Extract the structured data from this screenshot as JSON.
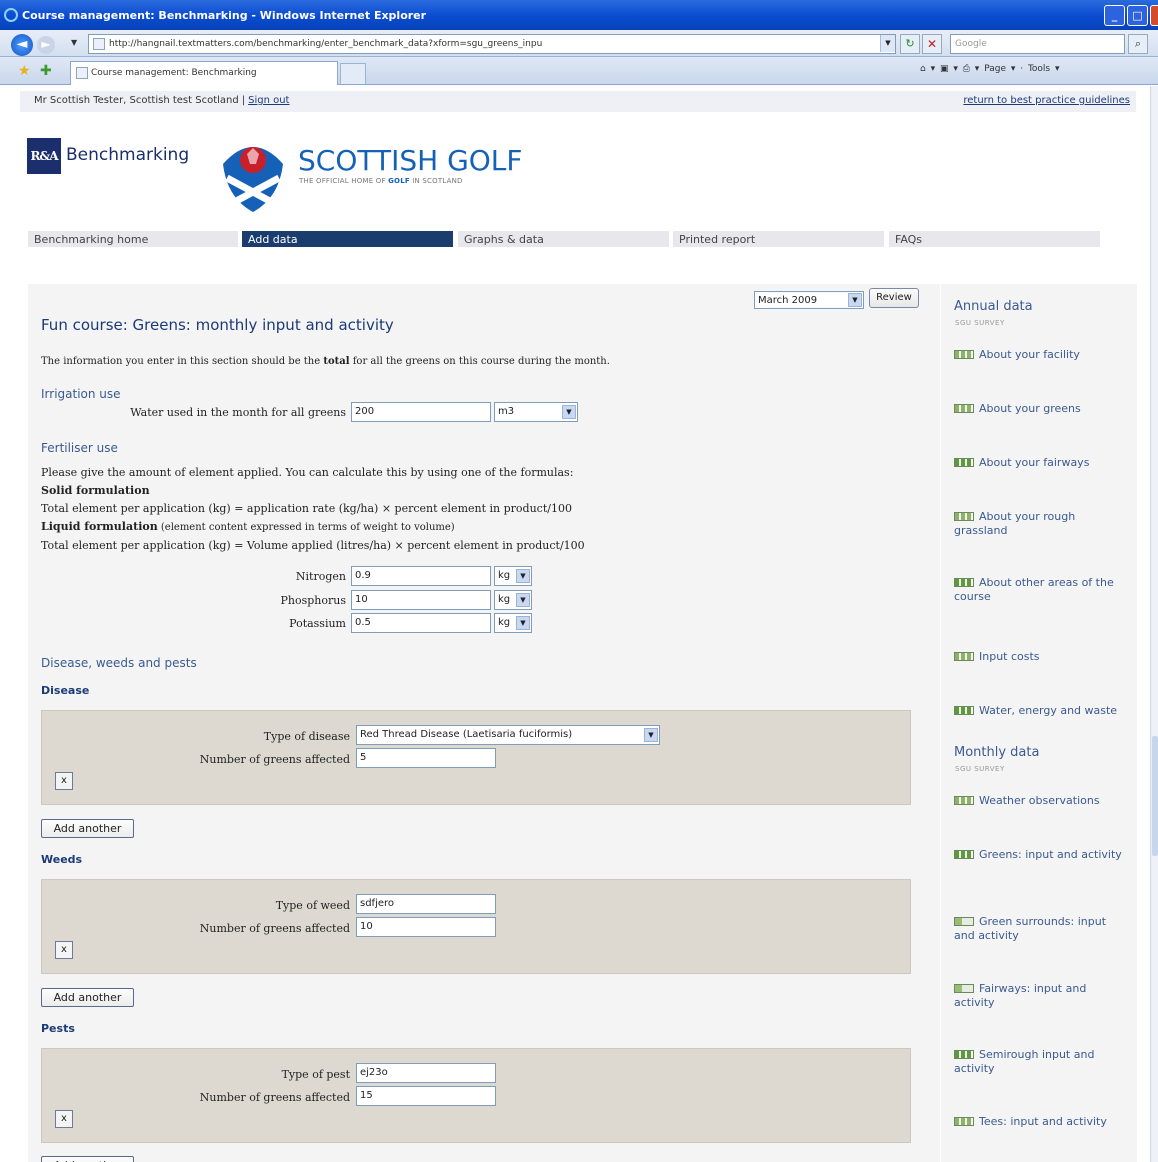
{
  "browser": {
    "window_title": "Course management: Benchmarking - Windows Internet Explorer",
    "url": "http://hangnail.textmatters.com/benchmarking/enter_benchmark_data?xform=sgu_greens_inpu",
    "search_placeholder": "Google",
    "tab_label": "Course management: Benchmarking",
    "toolbar_tools": "Page ▾ · Tools ▾"
  },
  "userbar": {
    "user": "Mr Scottish Tester, Scottish test Scotland",
    "separator": "|",
    "sign_out": "Sign out",
    "return_link": "return to best practice guidelines"
  },
  "logos": {
    "ra_mark": "R&A",
    "ra_text": "Benchmarking",
    "sg_title": "SCOTTISH GOLF",
    "sg_sub_a": "THE OFFICIAL HOME OF ",
    "sg_sub_b": "GOLF",
    "sg_sub_c": " IN SCOTLAND"
  },
  "nav": [
    "Benchmarking home",
    "Add data",
    "Graphs & data",
    "Printed report",
    "FAQs"
  ],
  "form": {
    "month": "March 2009",
    "review": "Review",
    "title": "Fun course: Greens: monthly input and activity",
    "intro_a": "The information you enter in this section should be the ",
    "intro_b": "total",
    "intro_c": " for all the greens on this course during the month.",
    "irrigation_heading": "Irrigation use",
    "water_label": "Water used in the month for all greens",
    "water_value": "200",
    "water_unit": "m3",
    "fertiliser_heading": "Fertiliser use",
    "fert_line1": "Please give the amount of element applied. You can calculate this by using one of the formulas:",
    "fert_solid": "Solid formulation",
    "fert_line3": "Total element per application (kg) = application rate (kg/ha) × percent element in product/100",
    "fert_liquid": "Liquid formulation",
    "fert_liquid_note": " (element content expressed in terms of weight to volume)",
    "fert_line5": "Total element per application (kg) = Volume applied (litres/ha) × percent element in product/100",
    "elements": [
      {
        "label": "Nitrogen",
        "value": "0.9",
        "unit": "kg"
      },
      {
        "label": "Phosphorus",
        "value": "10",
        "unit": "kg"
      },
      {
        "label": "Potassium",
        "value": "0.5",
        "unit": "kg"
      }
    ],
    "dwp_heading": "Disease, weeds and pests",
    "disease": {
      "heading": "Disease",
      "type_label": "Type of disease",
      "type_value": "Red Thread Disease (Laetisaria fuciformis)",
      "count_label": "Number of greens affected",
      "count_value": "5"
    },
    "weeds": {
      "heading": "Weeds",
      "type_label": "Type of weed",
      "type_value": "sdfjero",
      "count_label": "Number of greens affected",
      "count_value": "10"
    },
    "pests": {
      "heading": "Pests",
      "type_label": "Type of pest",
      "type_value": "ej23o",
      "count_label": "Number of greens affected",
      "count_value": "15"
    },
    "remove_label": "x",
    "add_another": "Add another"
  },
  "sidebar": {
    "annual_heading": "Annual data",
    "annual_sub": "SGU SURVEY",
    "annual_items": [
      {
        "label": "About your facility",
        "status": "partial"
      },
      {
        "label": "About your greens",
        "status": "partial"
      },
      {
        "label": "About your fairways",
        "status": "full"
      },
      {
        "label": "About your rough grassland",
        "status": "partial"
      },
      {
        "label": "About other areas of the course",
        "status": "full"
      },
      {
        "label": "Input costs",
        "status": "partial"
      },
      {
        "label": "Water, energy and waste",
        "status": "full"
      }
    ],
    "monthly_heading": "Monthly data",
    "monthly_sub": "SGU SURVEY",
    "monthly_items": [
      {
        "label": "Weather observations",
        "status": "partial"
      },
      {
        "label": "Greens: input and activity",
        "status": "full"
      },
      {
        "label": "Green surrounds: input and activity",
        "status": "low"
      },
      {
        "label": "Fairways: input and activity",
        "status": "low"
      },
      {
        "label": "Semirough input and activity",
        "status": "full"
      },
      {
        "label": "Tees: input and activity",
        "status": "partial"
      }
    ]
  }
}
